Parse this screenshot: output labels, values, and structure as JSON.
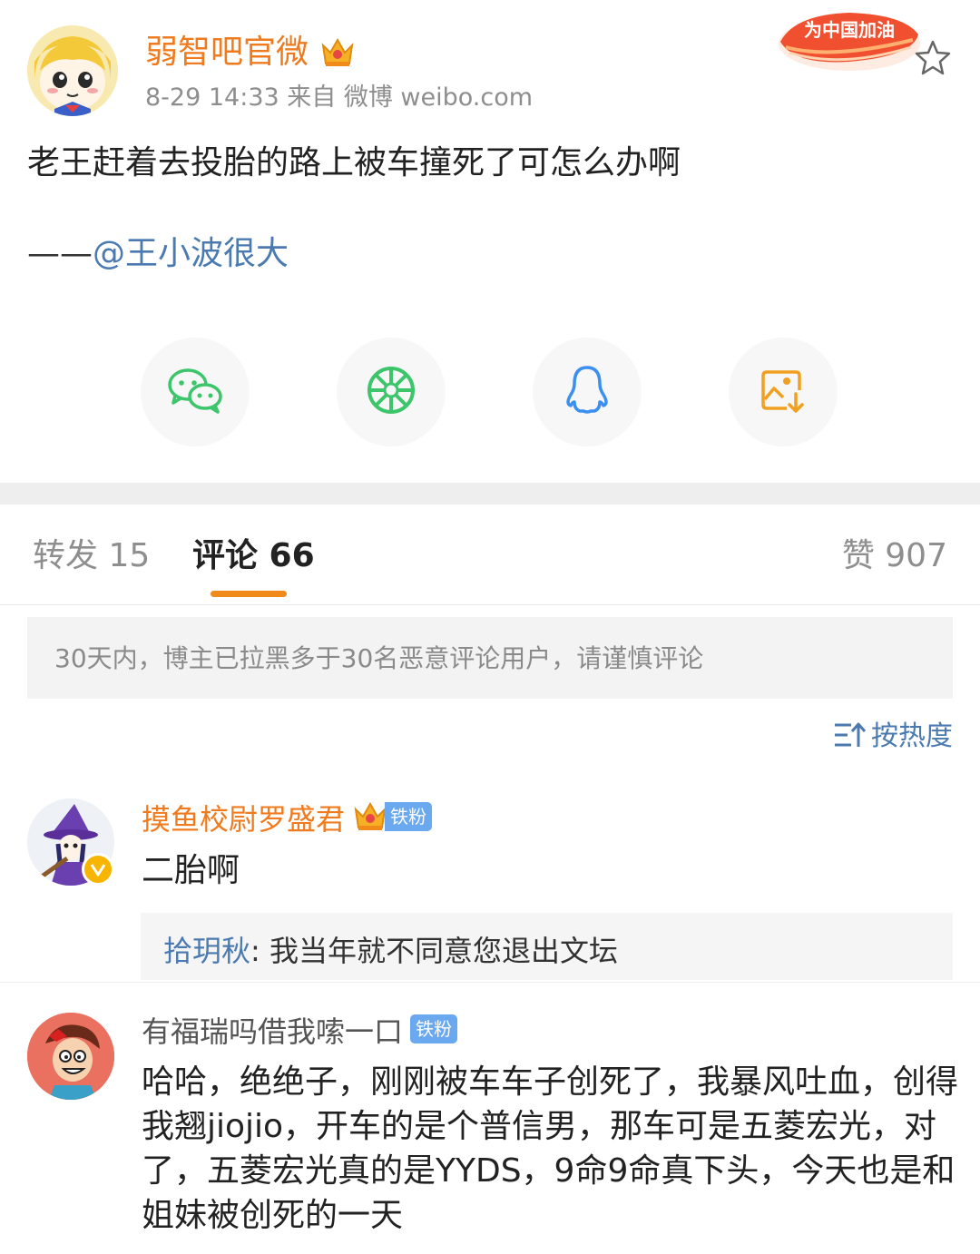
{
  "post": {
    "author": "弱智吧官微",
    "meta": "8-29 14:33  来自 微博 weibo.com",
    "badge_text": "为中国加油",
    "text": "老王赶着去投胎的路上被车撞死了可怎么办啊",
    "attrib_dash": "——",
    "attrib_mention": "@王小波很大"
  },
  "share": {
    "items": [
      "wechat-icon",
      "moments-icon",
      "qq-icon",
      "save-image-icon"
    ],
    "colors": {
      "wechat": "#3cc56b",
      "moments": "#3cc56b",
      "qq": "#3a8ff0",
      "save": "#f0a020"
    }
  },
  "tabs": {
    "repost": "转发 15",
    "comments": "评论 66",
    "likes": "赞 907"
  },
  "notice": "30天内，博主已拉黑多于30名恶意评论用户，请谨慎评论",
  "sort_label": "按热度",
  "comments": [
    {
      "name": "摸鱼校尉罗盛君",
      "fan_badge": "铁粉",
      "text": "二胎啊",
      "reply_user": "拾玥秋",
      "reply_sep": ": ",
      "reply_text": "我当年就不同意您退出文坛"
    },
    {
      "name": "有福瑞吗借我嗦一口",
      "fan_badge": "铁粉",
      "text": "哈哈，绝绝子，刚刚被车车子创死了，我暴风吐血，创得我翘jiojio，开车的是个普信男，那车可是五菱宏光，对了，五菱宏光真的是YYDS，9命9命真下头，今天也是和姐妹被创死的一天"
    }
  ],
  "colors": {
    "author_orange": "#f07b1f",
    "link_blue": "#4a7ab0",
    "tab_underline": "#f08a1b",
    "fan_badge_bg": "#6aa8f0"
  }
}
